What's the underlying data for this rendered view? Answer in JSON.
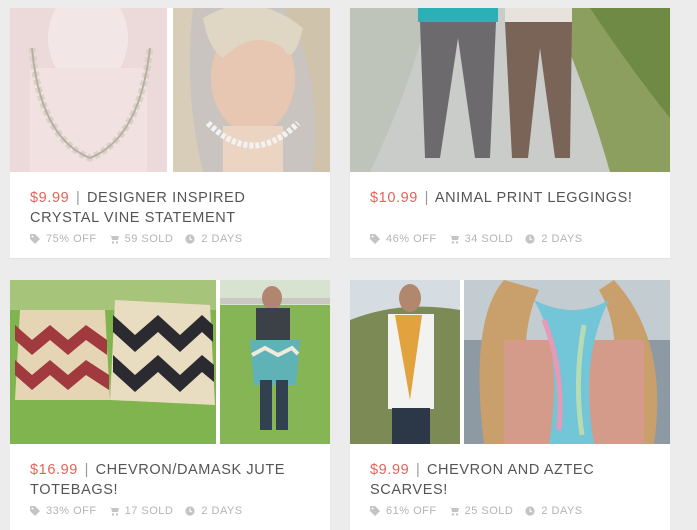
{
  "deals": [
    {
      "price": "$9.99",
      "separator": "|",
      "title": "DESIGNER INSPIRED CRYSTAL VINE STATEMENT",
      "off": "75% OFF",
      "sold": "59 SOLD",
      "time_left": "2 DAYS"
    },
    {
      "price": "$10.99",
      "separator": "|",
      "title": "ANIMAL PRINT LEGGINGS!",
      "off": "46% OFF",
      "sold": "34 SOLD",
      "time_left": "2 DAYS"
    },
    {
      "price": "$16.99",
      "separator": "|",
      "title": "CHEVRON/DAMASK JUTE TOTEBAGS!",
      "off": "33% OFF",
      "sold": "17 SOLD",
      "time_left": "2 DAYS"
    },
    {
      "price": "$9.99",
      "separator": "|",
      "title": "CHEVRON AND AZTEC SCARVES!",
      "off": "61% OFF",
      "sold": "25 SOLD",
      "time_left": "2 DAYS"
    }
  ],
  "icons": {
    "off": "tag-icon",
    "sold": "cart-icon",
    "time": "clock-icon"
  },
  "colors": {
    "price": "#e0645a",
    "title": "#555555",
    "meta": "#b4b4b4",
    "background": "#ececec"
  }
}
